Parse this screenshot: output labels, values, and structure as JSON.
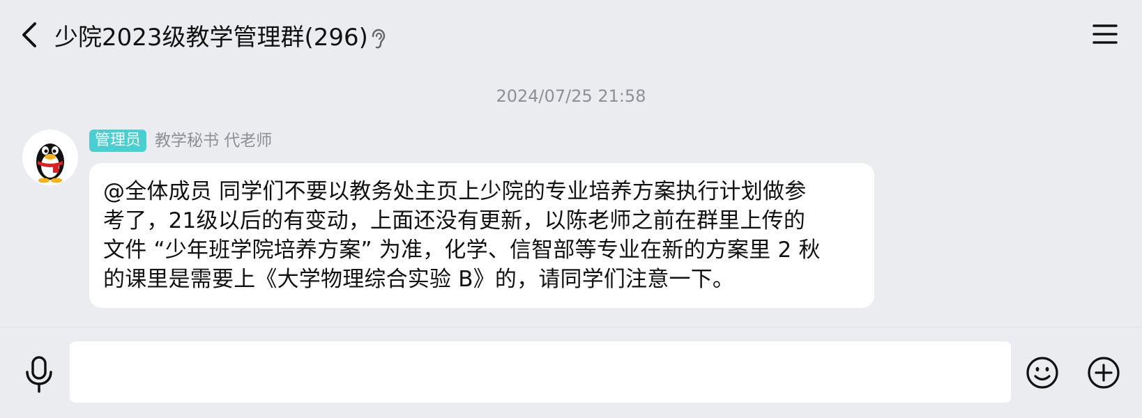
{
  "header": {
    "title": "少院2023级教学管理群(296)",
    "back_icon": "chevron-left-icon",
    "ear_icon": "ear-icon",
    "menu_icon": "hamburger-menu-icon"
  },
  "chat": {
    "timestamp": "2024/07/25 21:58",
    "messages": [
      {
        "avatar_icon": "qq-penguin-avatar",
        "badge": "管理员",
        "sender": "教学秘书 代老师",
        "lines": [
          "@全体成员 同学们不要以教务处主页上少院的专业培养方案执行计划做参",
          "考了，21级以后的有变动，上面还没有更新，以陈老师之前在群里上传的",
          "文件 “少年班学院培养方案” 为准，化学、信智部等专业在新的方案里 2 秋",
          "的课里是需要上《大学物理综合实验 B》的，请同学们注意一下。"
        ]
      }
    ]
  },
  "input_bar": {
    "mic_icon": "microphone-icon",
    "input_value": "",
    "emoji_icon": "smiley-icon",
    "plus_icon": "plus-circle-icon"
  },
  "colors": {
    "background": "#ebecf0",
    "badge": "#49cfd0",
    "bubble": "#ffffff",
    "secondary_text": "#8d8f96"
  }
}
